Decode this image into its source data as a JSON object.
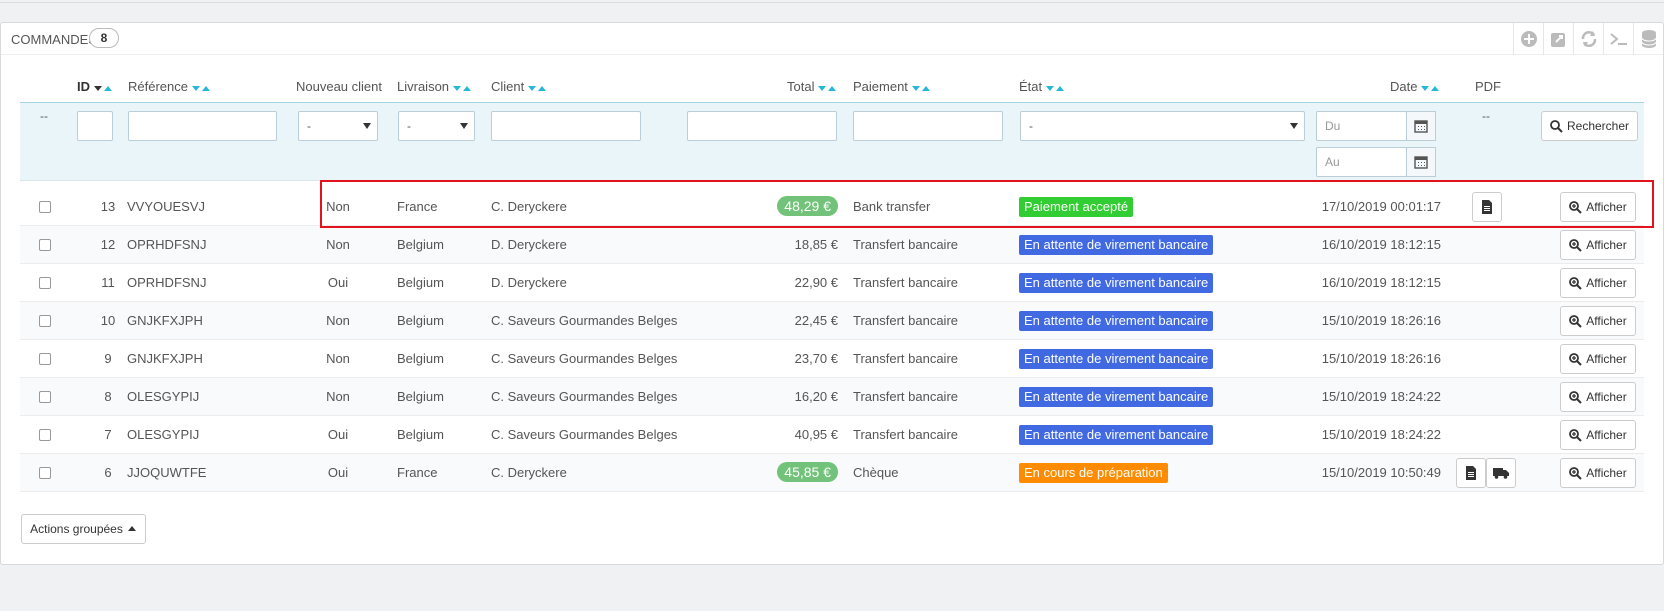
{
  "panel": {
    "title": "COMMANDES",
    "count": "8",
    "tools": [
      "add-icon",
      "export-icon",
      "refresh-icon",
      "sql-icon",
      "database-icon"
    ]
  },
  "columns": {
    "id": "ID",
    "reference": "Référence",
    "new_client": "Nouveau client",
    "delivery": "Livraison",
    "client": "Client",
    "total": "Total",
    "payment": "Paiement",
    "state": "État",
    "date": "Date",
    "pdf": "PDF"
  },
  "filters": {
    "bulk_placeholder": "--",
    "new_client_value": "-",
    "delivery_value": "-",
    "state_value": "-",
    "date_from_placeholder": "Du",
    "date_to_placeholder": "Au",
    "pdf_placeholder": "--",
    "search_label": "Rechercher"
  },
  "rows": [
    {
      "id": "13",
      "reference": "VVYOUESVJ",
      "new_client": "Non",
      "delivery": "France",
      "client": "C. Deryckere",
      "total": "48,29 €",
      "total_pill": true,
      "payment": "Bank transfer",
      "state": "Paiement accepté",
      "state_color": "#32cd32",
      "date": "17/10/2019 00:01:17",
      "pdf": [
        "invoice"
      ]
    },
    {
      "id": "12",
      "reference": "OPRHDFSNJ",
      "new_client": "Non",
      "delivery": "Belgium",
      "client": "D. Deryckere",
      "total": "18,85 €",
      "total_pill": false,
      "payment": "Transfert bancaire",
      "state": "En attente de virement bancaire",
      "state_color": "#4169e1",
      "date": "16/10/2019 18:12:15",
      "pdf": []
    },
    {
      "id": "11",
      "reference": "OPRHDFSNJ",
      "new_client": "Oui",
      "delivery": "Belgium",
      "client": "D. Deryckere",
      "total": "22,90 €",
      "total_pill": false,
      "payment": "Transfert bancaire",
      "state": "En attente de virement bancaire",
      "state_color": "#4169e1",
      "date": "16/10/2019 18:12:15",
      "pdf": []
    },
    {
      "id": "10",
      "reference": "GNJKFXJPH",
      "new_client": "Non",
      "delivery": "Belgium",
      "client": "C. Saveurs Gourmandes Belges",
      "total": "22,45 €",
      "total_pill": false,
      "payment": "Transfert bancaire",
      "state": "En attente de virement bancaire",
      "state_color": "#4169e1",
      "date": "15/10/2019 18:26:16",
      "pdf": []
    },
    {
      "id": "9",
      "reference": "GNJKFXJPH",
      "new_client": "Non",
      "delivery": "Belgium",
      "client": "C. Saveurs Gourmandes Belges",
      "total": "23,70 €",
      "total_pill": false,
      "payment": "Transfert bancaire",
      "state": "En attente de virement bancaire",
      "state_color": "#4169e1",
      "date": "15/10/2019 18:26:16",
      "pdf": []
    },
    {
      "id": "8",
      "reference": "OLESGYPIJ",
      "new_client": "Non",
      "delivery": "Belgium",
      "client": "C. Saveurs Gourmandes Belges",
      "total": "16,20 €",
      "total_pill": false,
      "payment": "Transfert bancaire",
      "state": "En attente de virement bancaire",
      "state_color": "#4169e1",
      "date": "15/10/2019 18:24:22",
      "pdf": []
    },
    {
      "id": "7",
      "reference": "OLESGYPIJ",
      "new_client": "Oui",
      "delivery": "Belgium",
      "client": "C. Saveurs Gourmandes Belges",
      "total": "40,95 €",
      "total_pill": false,
      "payment": "Transfert bancaire",
      "state": "En attente de virement bancaire",
      "state_color": "#4169e1",
      "date": "15/10/2019 18:24:22",
      "pdf": []
    },
    {
      "id": "6",
      "reference": "JJOQUWTFE",
      "new_client": "Oui",
      "delivery": "France",
      "client": "C. Deryckere",
      "total": "45,85 €",
      "total_pill": true,
      "payment": "Chèque",
      "state": "En cours de préparation",
      "state_color": "#ff8c00",
      "date": "15/10/2019 10:50:49",
      "pdf": [
        "invoice",
        "delivery"
      ]
    }
  ],
  "row_action_label": "Afficher",
  "bulk_actions_label": "Actions groupées"
}
